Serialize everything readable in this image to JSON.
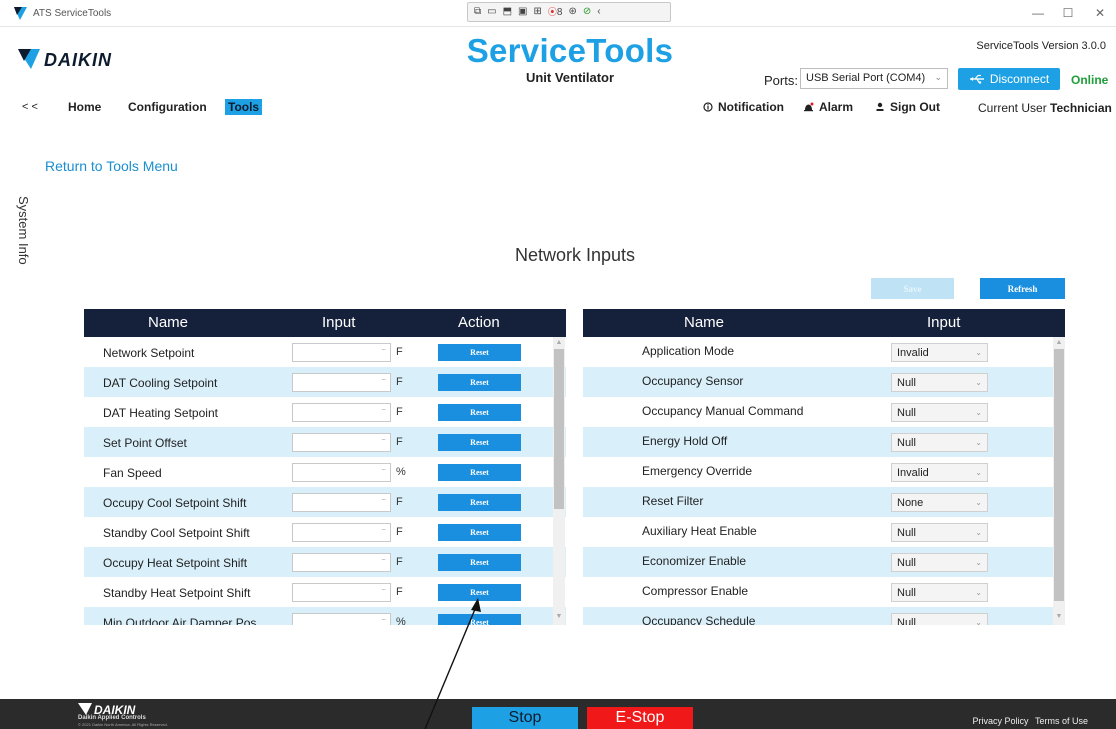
{
  "window": {
    "title": "ATS ServiceTools",
    "minimize": "—",
    "maximize": "☐",
    "close": "✕"
  },
  "toolbar_float": {
    "rec_count": "8"
  },
  "header": {
    "logo_text": "DAIKIN",
    "app_title": "ServiceTools",
    "app_subtitle": "Unit Ventilator",
    "version": "ServiceTools Version  3.0.0",
    "ports_label": "Ports:",
    "ports_value": "USB Serial Port (COM4)",
    "disconnect_label": "Disconnect",
    "status": "Online"
  },
  "nav": {
    "back": "< <",
    "items": [
      "Home",
      "Configuration",
      "Tools"
    ],
    "notification": "Notification",
    "alarm": "Alarm",
    "sign_out": "Sign Out",
    "current_user_label": "Current User",
    "current_user": "Technician"
  },
  "return_link": "Return to Tools Menu",
  "side_tab": "System Info",
  "page_title": "Network Inputs",
  "actions": {
    "save": "Save",
    "refresh": "Refresh"
  },
  "left_table": {
    "headers": [
      "Name",
      "Input",
      "Action"
    ],
    "reset_label": "Reset",
    "rows": [
      {
        "name": "Network Setpoint",
        "input": "",
        "unit": "F"
      },
      {
        "name": "DAT Cooling Setpoint",
        "input": "",
        "unit": "F"
      },
      {
        "name": "DAT Heating Setpoint",
        "input": "",
        "unit": "F"
      },
      {
        "name": "Set Point Offset",
        "input": "",
        "unit": "F"
      },
      {
        "name": "Fan Speed",
        "input": "",
        "unit": "%"
      },
      {
        "name": "Occupy Cool Setpoint Shift",
        "input": "",
        "unit": "F"
      },
      {
        "name": "Standby Cool Setpoint Shift",
        "input": "",
        "unit": "F"
      },
      {
        "name": "Occupy Heat Setpoint Shift",
        "input": "",
        "unit": "F"
      },
      {
        "name": "Standby Heat Setpoint Shift",
        "input": "",
        "unit": "F"
      },
      {
        "name": "Min Outdoor Air Damper Pos",
        "input": "",
        "unit": "%"
      }
    ]
  },
  "right_table": {
    "headers": [
      "Name",
      "Input"
    ],
    "rows": [
      {
        "name": "Application Mode",
        "value": "Invalid"
      },
      {
        "name": "Occupancy Sensor",
        "value": "Null"
      },
      {
        "name": "Occupancy Manual Command",
        "value": "Null"
      },
      {
        "name": "Energy Hold Off",
        "value": "Null"
      },
      {
        "name": "Emergency Override",
        "value": "Invalid"
      },
      {
        "name": "Reset Filter",
        "value": "None"
      },
      {
        "name": "Auxiliary Heat Enable",
        "value": "Null"
      },
      {
        "name": "Economizer Enable",
        "value": "Null"
      },
      {
        "name": "Compressor Enable",
        "value": "Null"
      },
      {
        "name": "Occupancy Schedule",
        "value": "Null"
      }
    ]
  },
  "footer": {
    "logo_text": "DAIKIN",
    "company": "Daikin Applied Controls",
    "copyright": "© 2021 Daikin North America. All Rights Reserved.",
    "stop": "Stop",
    "estop": "E-Stop",
    "privacy": "Privacy Policy",
    "terms": "Terms of Use"
  },
  "colors": {
    "brand_blue": "#1ea1e4",
    "header_navy": "#15203a",
    "row_alt": "#d9f0fb",
    "online_green": "#1f9e3a",
    "estop_red": "#f01818"
  }
}
